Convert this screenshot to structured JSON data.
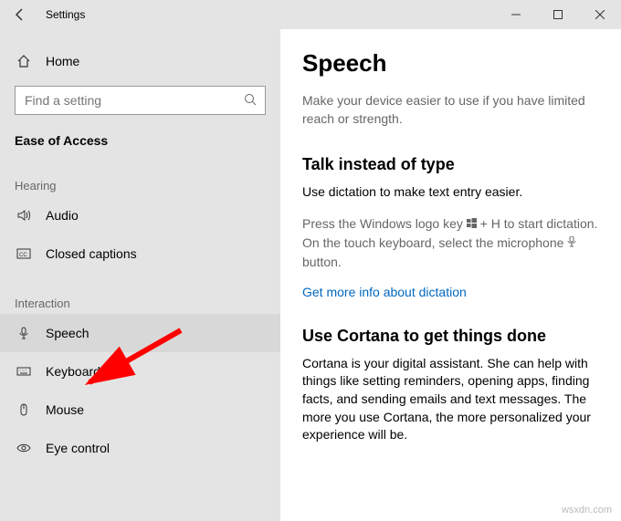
{
  "titlebar": {
    "title": "Settings"
  },
  "sidebar": {
    "home": "Home",
    "search_placeholder": "Find a setting",
    "category": "Ease of Access",
    "groups": [
      {
        "label": "Hearing",
        "items": [
          {
            "icon": "audio-icon",
            "label": "Audio"
          },
          {
            "icon": "cc-icon",
            "label": "Closed captions"
          }
        ]
      },
      {
        "label": "Interaction",
        "items": [
          {
            "icon": "microphone-icon",
            "label": "Speech"
          },
          {
            "icon": "keyboard-icon",
            "label": "Keyboard"
          },
          {
            "icon": "mouse-icon",
            "label": "Mouse"
          },
          {
            "icon": "eye-icon",
            "label": "Eye control"
          }
        ]
      }
    ]
  },
  "main": {
    "title": "Speech",
    "intro": "Make your device easier to use if you have limited reach or strength.",
    "section1_title": "Talk instead of type",
    "section1_line1": "Use dictation to make text entry easier.",
    "section1_hint_a": "Press the Windows logo key ",
    "section1_hint_b": " + H to start dictation. On the touch keyboard, select the microphone ",
    "section1_hint_c": " button.",
    "section1_link": "Get more info about dictation",
    "section2_title": "Use Cortana to get things done",
    "section2_body": "Cortana is your digital assistant.  She can help with things like setting reminders, opening apps, finding facts, and sending emails and text messages.  The more you use Cortana, the more personalized your experience will be."
  },
  "watermark": "wsxdn.com"
}
